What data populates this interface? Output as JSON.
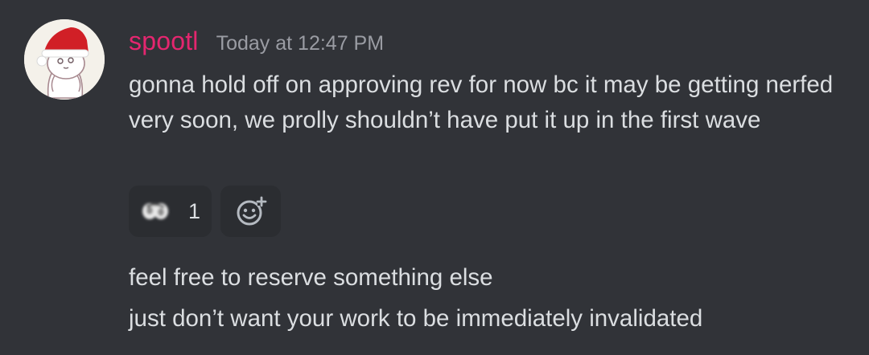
{
  "message": {
    "author": "spootl",
    "timestamp": "Today at 12:47 PM",
    "content": "gonna hold off on approving rev for now bc it may be getting nerfed very soon, we prolly shouldn’t have put it up in the first wave",
    "author_color": "#e4266f"
  },
  "reactions": [
    {
      "emoji": "custom-blurred-emoji-icon",
      "count": "1"
    }
  ],
  "add_reaction_icon": "add-reaction-icon",
  "followups": [
    "feel free to reserve something else",
    "just don’t want your work to be immediately invalidated"
  ],
  "colors": {
    "background": "#313338",
    "text": "#dbdee1",
    "muted": "#9a9ca3",
    "reaction_bg": "#2b2d31"
  }
}
